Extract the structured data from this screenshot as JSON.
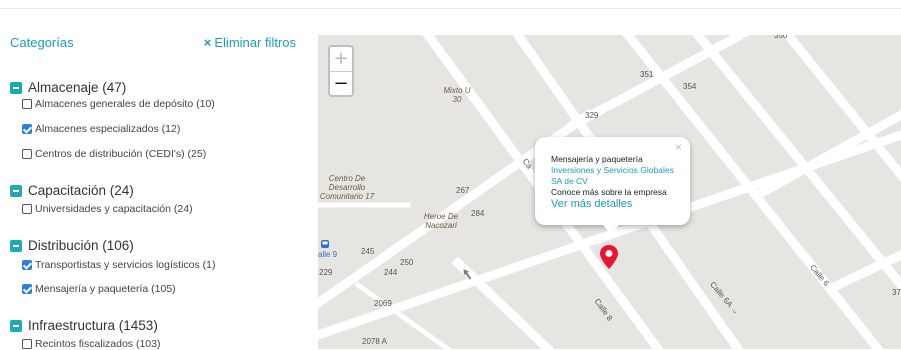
{
  "sidebar": {
    "title": "Categorías",
    "clear_label": "Eliminar filtros",
    "clear_icon": "×",
    "categories": [
      {
        "label": "Almacenaje (47)",
        "items": [
          {
            "label": "Almacenes generales de depósito (10)",
            "checked": false
          },
          {
            "label": "Almacenes especializados (12)",
            "checked": true
          },
          {
            "label": "Centros de distribución (CEDI's) (25)",
            "checked": false
          }
        ]
      },
      {
        "label": "Capacitación (24)",
        "items": [
          {
            "label": "Universidades y capacitación (24)",
            "checked": false
          }
        ]
      },
      {
        "label": "Distribución (106)",
        "items": [
          {
            "label": "Transportistas y servicios logísticos (1)",
            "checked": true
          },
          {
            "label": "Mensajería y paquetería (105)",
            "checked": true
          }
        ]
      },
      {
        "label": "Infraestructura (1453)",
        "items": [
          {
            "label": "Recintos fiscalizados (103)",
            "checked": false
          }
        ]
      }
    ]
  },
  "map": {
    "zoom_in": "+",
    "zoom_out": "−",
    "numbers": [
      "350",
      "351",
      "354",
      "329",
      "267",
      "284",
      "245",
      "250",
      "244",
      "229",
      "2069",
      "2078 A",
      "37"
    ],
    "places": [
      "Mixto U 30",
      "Centro De Desarrollo Comunitario 17",
      "Heroe De Nacozari"
    ],
    "streets": [
      "Calle 6",
      "Calle 6A →",
      "Calle 8",
      "Ca"
    ],
    "bus_label": "alle 9",
    "popup": {
      "category": "Mensajería y paquetería",
      "company": "Inversiones y Servicios Globales SA de CV",
      "info": "Conoce más sobre la empresa",
      "details": "Ver más detalles",
      "close": "×"
    },
    "colors": {
      "background": "#e7e5e1",
      "road": "#ffffff",
      "marker": "#e8152f",
      "accent": "#1d9bb8"
    }
  }
}
